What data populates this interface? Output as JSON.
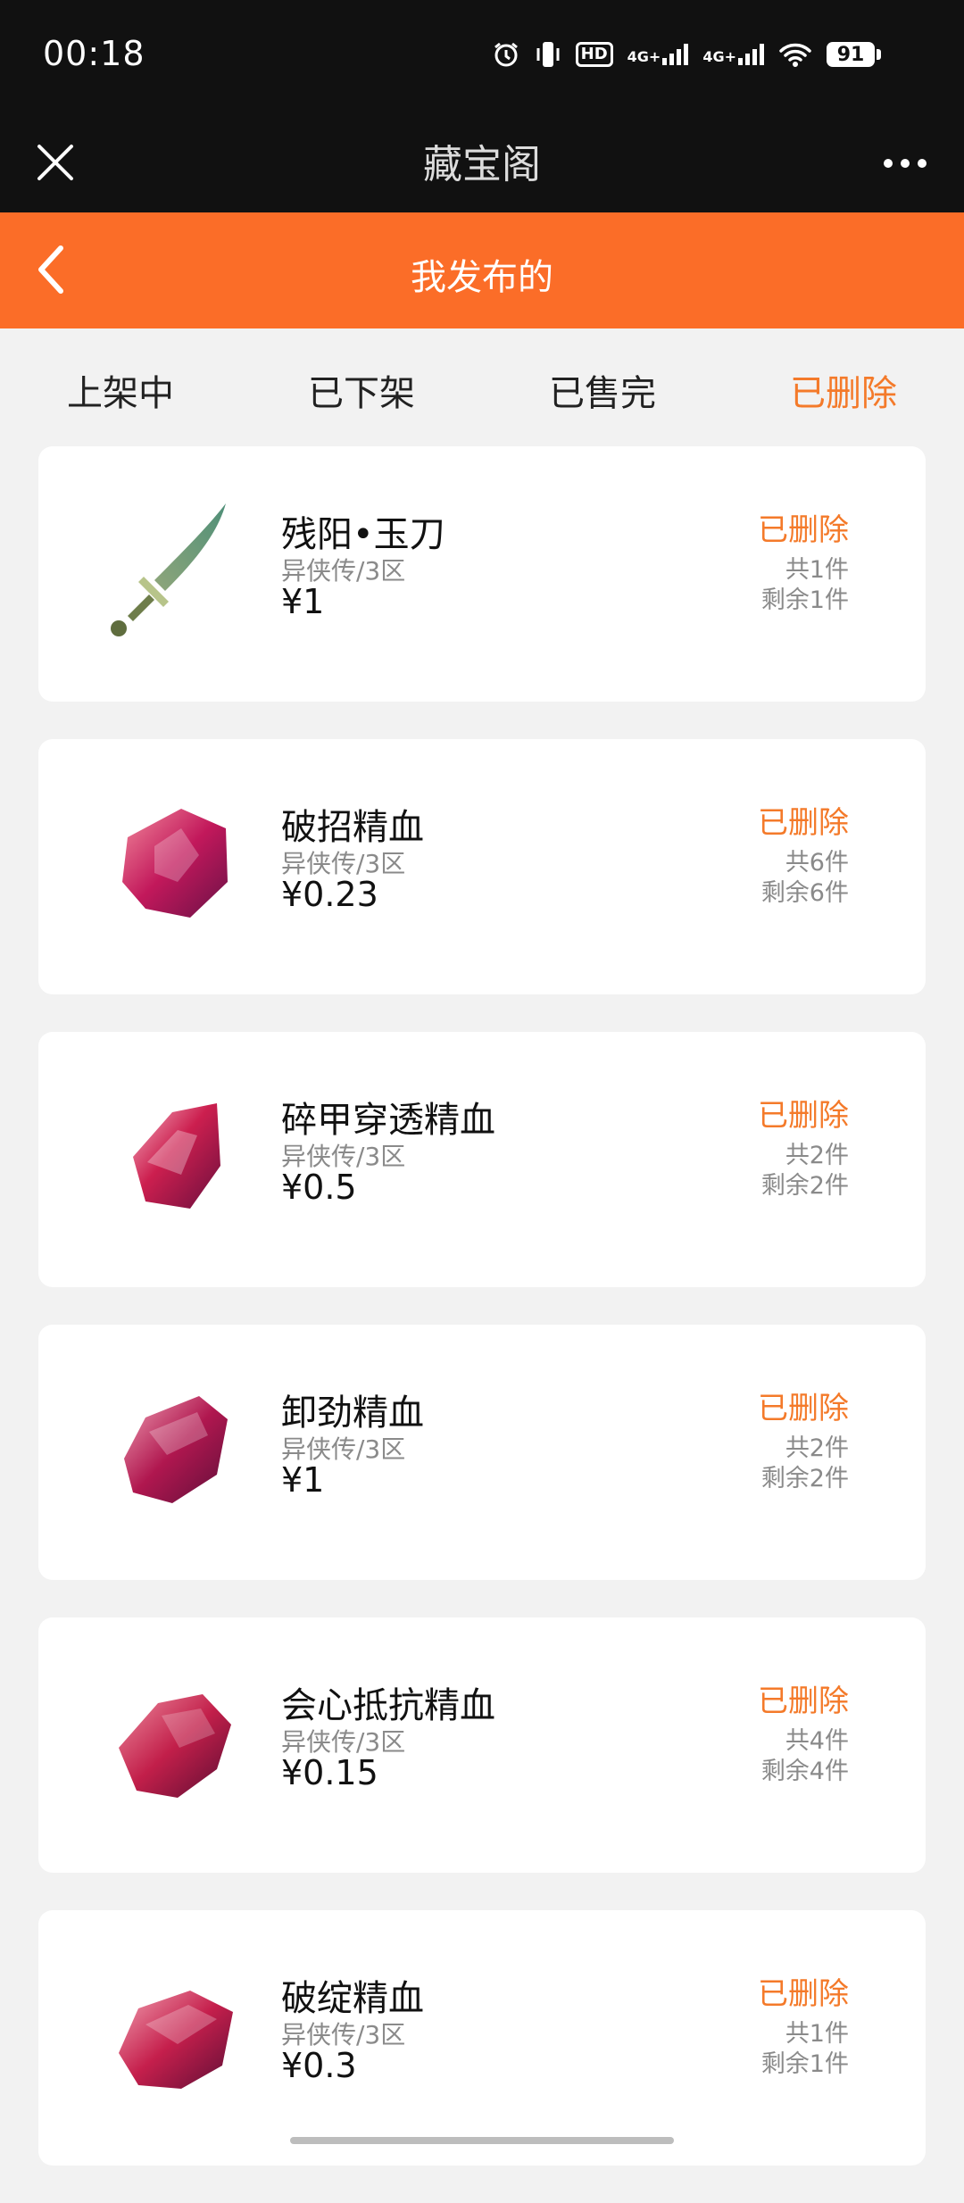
{
  "status_bar": {
    "time": "00:18",
    "battery": "91",
    "hd_label": "HD",
    "net1_label": "4G+",
    "net2_label": "4G+"
  },
  "titlebar": {
    "title": "藏宝阁"
  },
  "header": {
    "title": "我发布的"
  },
  "tabs": [
    {
      "label": "上架中"
    },
    {
      "label": "已下架"
    },
    {
      "label": "已售完"
    },
    {
      "label": "已删除"
    }
  ],
  "colors": {
    "accent": "#fb6d28",
    "status": "#f47a2a",
    "titlebar": "#111111"
  },
  "items": [
    {
      "name": "残阳•玉刀",
      "server": "异侠传/3区",
      "price": "¥1",
      "status": "已删除",
      "total": "共1件",
      "remain": "剩余1件",
      "icon": "jade-sword-icon"
    },
    {
      "name": "破招精血",
      "server": "异侠传/3区",
      "price": "¥0.23",
      "status": "已删除",
      "total": "共6件",
      "remain": "剩余6件",
      "icon": "blood-crystal-icon"
    },
    {
      "name": "碎甲穿透精血",
      "server": "异侠传/3区",
      "price": "¥0.5",
      "status": "已删除",
      "total": "共2件",
      "remain": "剩余2件",
      "icon": "blood-crystal-icon"
    },
    {
      "name": "卸劲精血",
      "server": "异侠传/3区",
      "price": "¥1",
      "status": "已删除",
      "total": "共2件",
      "remain": "剩余2件",
      "icon": "blood-crystal-icon"
    },
    {
      "name": "会心抵抗精血",
      "server": "异侠传/3区",
      "price": "¥0.15",
      "status": "已删除",
      "total": "共4件",
      "remain": "剩余4件",
      "icon": "blood-crystal-icon"
    },
    {
      "name": "破绽精血",
      "server": "异侠传/3区",
      "price": "¥0.3",
      "status": "已删除",
      "total": "共1件",
      "remain": "剩余1件",
      "icon": "blood-crystal-icon"
    }
  ]
}
